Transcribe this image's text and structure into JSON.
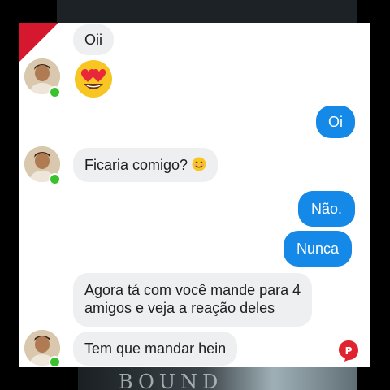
{
  "background_text": "BOUND",
  "messages": {
    "m1": "Oii",
    "m2": "Oi",
    "m3": "Ficaria comigo?",
    "m4": "Não.",
    "m5": "Nunca",
    "m6_line1": "Agora tá com você mande para 4",
    "m6_line2": "amigos e veja a reação deles",
    "m7": "Tem que mandar hein"
  },
  "colors": {
    "outgoing_bubble": "#1589e8",
    "incoming_bubble": "#eeeff1",
    "online_dot": "#3ac22e",
    "corner_ribbon": "#d6182e",
    "logo": "#e0242f"
  },
  "icons": {
    "heart_eyes": "heart-eyes-emoji",
    "smile": "smiling-face-emoji",
    "logo": "watermark-logo"
  }
}
